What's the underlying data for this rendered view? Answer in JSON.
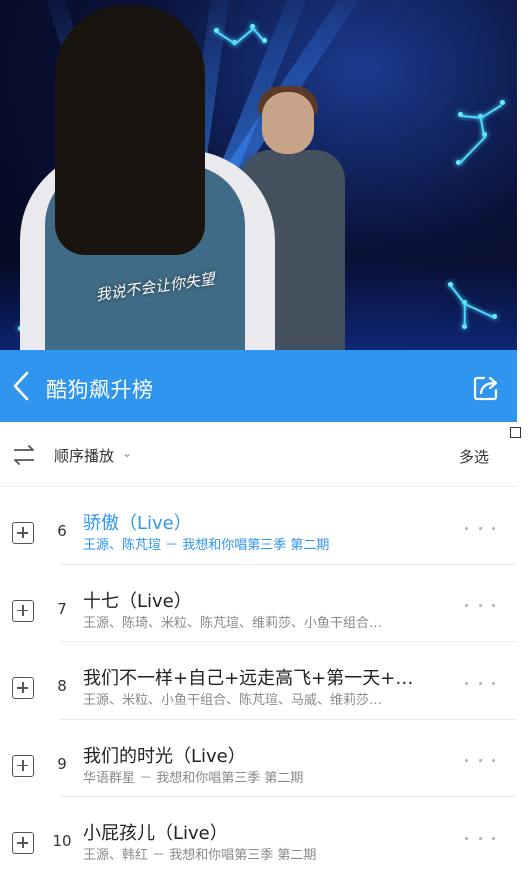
{
  "hero": {
    "subtitle": "我说不会让你失望"
  },
  "titlebar": {
    "title": "酷狗飙升榜",
    "back_icon": "chevron-left-icon",
    "share_icon": "share-icon",
    "background_color": "#2f95ee"
  },
  "toolbar": {
    "order_icon": "shuffle-order-icon",
    "order_label": "顺序播放",
    "order_caret": "⌄",
    "multi_select_label": "多选"
  },
  "songs": [
    {
      "rank": "6",
      "title": "骄傲（Live）",
      "meta": "王源、陈芃瑄 － 我想和你唱第三季 第二期",
      "active": true
    },
    {
      "rank": "7",
      "title": "十七（Live）",
      "meta": "王源、陈琦、米粒、陈芃瑄、维莉莎、小鱼干组合…",
      "active": false
    },
    {
      "rank": "8",
      "title": "我们不一样+自己+远走高飞+第一天+…",
      "meta": "王源、米粒、小鱼干组合、陈芃瑄、马威、维莉莎…",
      "active": false
    },
    {
      "rank": "9",
      "title": "我们的时光（Live）",
      "meta": "华语群星 － 我想和你唱第三季 第二期",
      "active": false
    },
    {
      "rank": "10",
      "title": "小屁孩儿（Live）",
      "meta": "王源、韩红 － 我想和你唱第三季 第二期",
      "active": false
    }
  ],
  "colors": {
    "accent": "#2f95ee",
    "meta_text": "#8a8a8a"
  }
}
